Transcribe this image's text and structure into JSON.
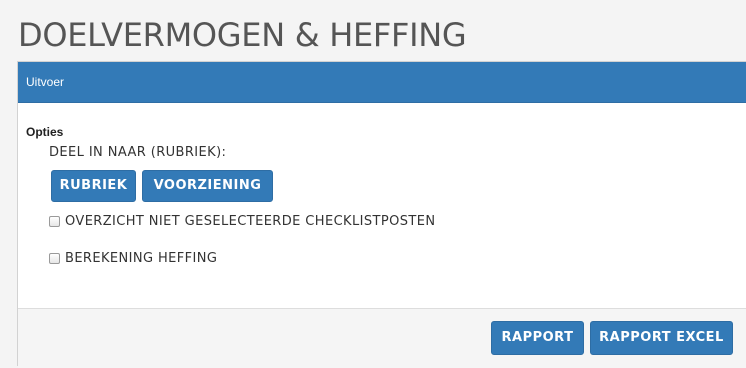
{
  "page": {
    "title": "DOELVERMOGEN & HEFFING"
  },
  "panel": {
    "header": "Uitvoer",
    "options_label": "Opties",
    "group_label": "DEEL IN NAAR (RUBRIEK):",
    "group_buttons": [
      "RUBRIEK",
      "VOORZIENING"
    ],
    "checkboxes": [
      {
        "label": "OVERZICHT NIET GESELECTEERDE CHECKLISTPOSTEN",
        "checked": false
      },
      {
        "label": "BEREKENING HEFFING",
        "checked": false
      }
    ],
    "footer_buttons": [
      "RAPPORT",
      "RAPPORT EXCEL"
    ]
  },
  "colors": {
    "primary": "#337ab7",
    "title_text": "#555555",
    "footer_bg": "#f5f5f5"
  }
}
